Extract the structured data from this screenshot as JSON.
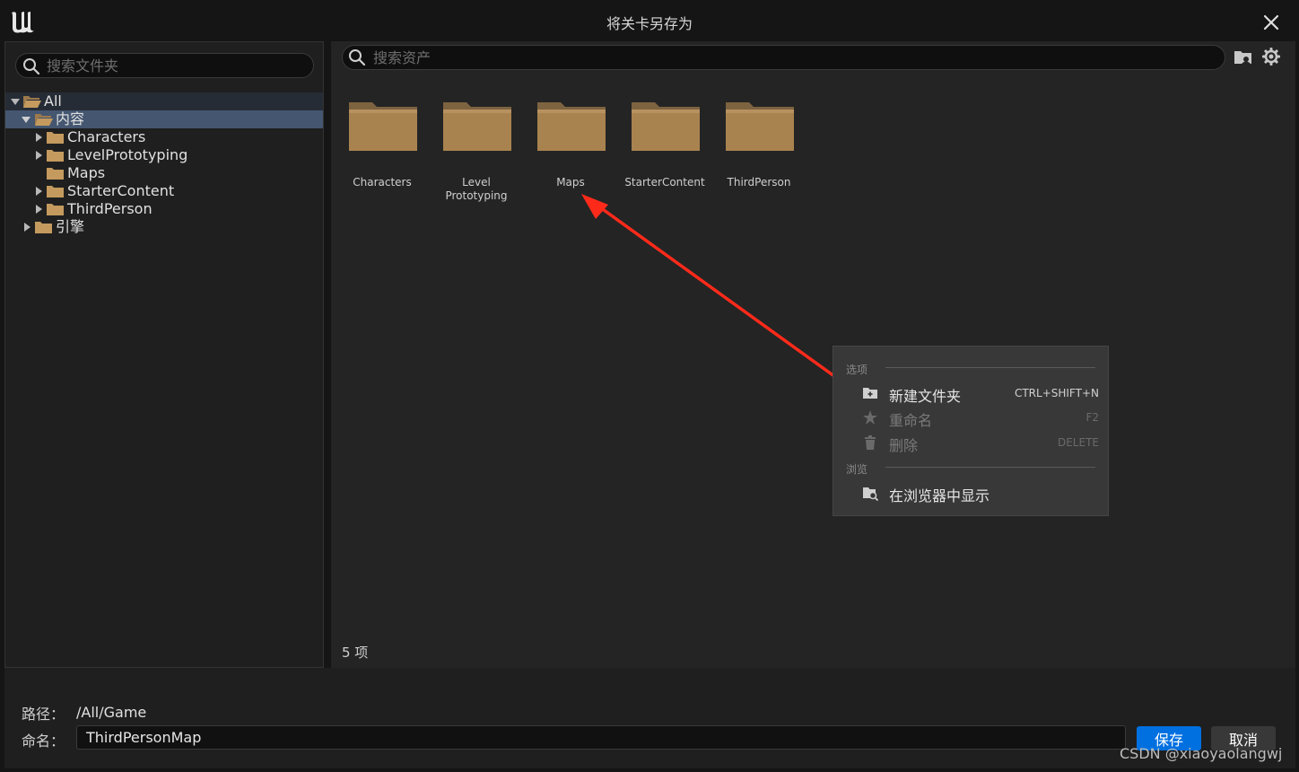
{
  "window": {
    "title": "将关卡另存为"
  },
  "folder_panel": {
    "search_placeholder": "搜索文件夹",
    "tree": [
      {
        "label": "All",
        "expanded": true
      },
      {
        "label": "内容",
        "expanded": true,
        "selected": true
      },
      {
        "label": "Characters"
      },
      {
        "label": "LevelPrototyping"
      },
      {
        "label": "Maps"
      },
      {
        "label": "StarterContent"
      },
      {
        "label": "ThirdPerson"
      },
      {
        "label": "引擎"
      }
    ]
  },
  "asset_panel": {
    "search_placeholder": "搜索资产",
    "folders": [
      {
        "label": "Characters"
      },
      {
        "label": "Level\nPrototyping"
      },
      {
        "label": "Maps"
      },
      {
        "label": "StarterContent"
      },
      {
        "label": "ThirdPerson"
      }
    ],
    "item_count": "5 项"
  },
  "context_menu": {
    "section_options": "选项",
    "new_folder": {
      "label": "新建文件夹",
      "shortcut": "CTRL+SHIFT+N"
    },
    "rename": {
      "label": "重命名",
      "shortcut": "F2"
    },
    "delete": {
      "label": "删除",
      "shortcut": "DELETE"
    },
    "section_browse": "浏览",
    "show_in_browser": {
      "label": "在浏览器中显示"
    }
  },
  "footer": {
    "path_label": "路径：",
    "path_value": "/All/Game",
    "name_label": "命名：",
    "name_value": "ThirdPersonMap",
    "save_label": "保存",
    "cancel_label": "取消"
  },
  "watermark": "CSDN @xiaoyaolangwj",
  "colors": {
    "accent": "#0070e0",
    "selection": "#445670",
    "folder": "#b08a56",
    "annotation_arrow": "#ff2a1a"
  }
}
